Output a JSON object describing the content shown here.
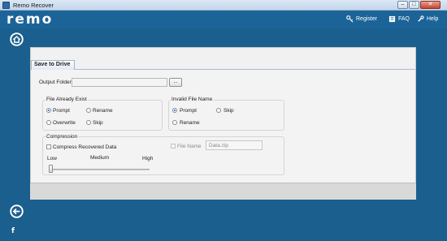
{
  "window": {
    "title": "Remo Recover",
    "minimize": "–",
    "maximize": "□",
    "close": "✕"
  },
  "header": {
    "logo": "remo",
    "links": {
      "register": "Register",
      "faq": "FAQ",
      "help": "Help"
    }
  },
  "tabs": [
    "Save to Drive"
  ],
  "output_folder": {
    "label": "Output Folder",
    "value": "",
    "browse_label": "..."
  },
  "file_already_exist": {
    "title": "File Already Exist",
    "options": [
      {
        "label": "Prompt",
        "selected": true
      },
      {
        "label": "Rename",
        "selected": false
      },
      {
        "label": "Overwrite",
        "selected": false
      },
      {
        "label": "Skip",
        "selected": false
      }
    ]
  },
  "invalid_file_name": {
    "title": "Invalid File Name",
    "options": [
      {
        "label": "Prompt",
        "selected": true
      },
      {
        "label": "Skip",
        "selected": false
      },
      {
        "label": "Rename",
        "selected": false
      }
    ]
  },
  "compression": {
    "title": "Compression",
    "compress_label": "Compress Recovered Data",
    "compress_checked": false,
    "level_labels": {
      "low": "Low",
      "medium": "Medium",
      "high": "High"
    },
    "level": 0,
    "file_name_label": "File Name",
    "file_name_enabled": false,
    "file_name_value": "Data.zip"
  },
  "sidebar": {
    "home_icon": "home-icon",
    "back_icon": "back-arrow-icon",
    "facebook": "f"
  },
  "colors": {
    "header": "#1c6498",
    "background": "#1a5f8e",
    "panel": "#f1f1f1"
  }
}
